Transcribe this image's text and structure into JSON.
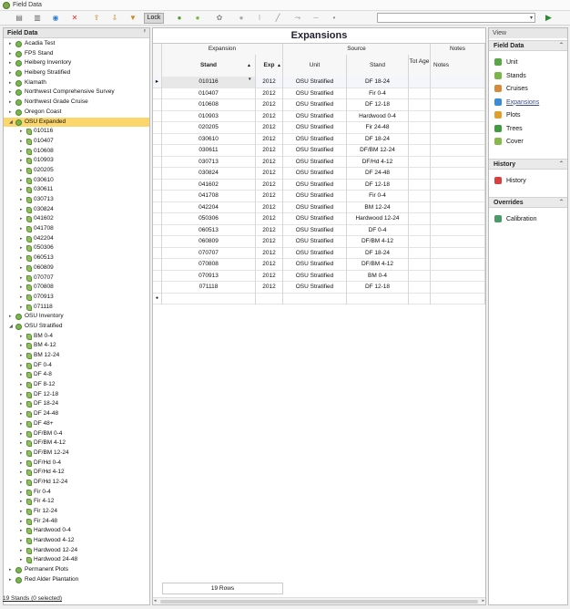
{
  "window": {
    "title": "Field Data"
  },
  "toolbar": {
    "lock_label": "Lock",
    "icons": [
      "save-icon",
      "save-all-icon",
      "view-icon",
      "delete-icon",
      "export-icon",
      "import-icon",
      "filter-icon",
      "node-icon",
      "stand-icon",
      "gear-icon",
      "circle-icon",
      "pin-icon",
      "line-icon",
      "split-icon",
      "arrow-icon",
      "dot-icon"
    ],
    "combo_value": "",
    "run_icon": "play-icon"
  },
  "left_panel": {
    "title": "Field Data",
    "items": [
      {
        "label": "Acadia Test",
        "level": 0,
        "toggle": "▸",
        "icon": "node"
      },
      {
        "label": "FPS Stand",
        "level": 0,
        "toggle": "▸",
        "icon": "node"
      },
      {
        "label": "Heiberg Inventory",
        "level": 0,
        "toggle": "▸",
        "icon": "node"
      },
      {
        "label": "Heiberg Stratified",
        "level": 0,
        "toggle": "▸",
        "icon": "node"
      },
      {
        "label": "Klamath",
        "level": 0,
        "toggle": "▸",
        "icon": "node"
      },
      {
        "label": "Northwest Comprehensive Survey",
        "level": 0,
        "toggle": "▸",
        "icon": "node"
      },
      {
        "label": "Northwest Grade Cruise",
        "level": 0,
        "toggle": "▸",
        "icon": "node"
      },
      {
        "label": "Oregon Coast",
        "level": 0,
        "toggle": "▸",
        "icon": "node"
      },
      {
        "label": "OSU Expanded",
        "level": 0,
        "toggle": "◢",
        "icon": "node",
        "selected": true
      },
      {
        "label": "010116",
        "level": 1,
        "toggle": "▸",
        "icon": "stand"
      },
      {
        "label": "010407",
        "level": 1,
        "toggle": "▸",
        "icon": "stand"
      },
      {
        "label": "010608",
        "level": 1,
        "toggle": "▸",
        "icon": "stand"
      },
      {
        "label": "010903",
        "level": 1,
        "toggle": "▸",
        "icon": "stand"
      },
      {
        "label": "020205",
        "level": 1,
        "toggle": "▸",
        "icon": "stand"
      },
      {
        "label": "030610",
        "level": 1,
        "toggle": "▸",
        "icon": "stand"
      },
      {
        "label": "030611",
        "level": 1,
        "toggle": "▸",
        "icon": "stand"
      },
      {
        "label": "030713",
        "level": 1,
        "toggle": "▸",
        "icon": "stand"
      },
      {
        "label": "030824",
        "level": 1,
        "toggle": "▸",
        "icon": "stand"
      },
      {
        "label": "041602",
        "level": 1,
        "toggle": "▸",
        "icon": "stand"
      },
      {
        "label": "041708",
        "level": 1,
        "toggle": "▸",
        "icon": "stand"
      },
      {
        "label": "042204",
        "level": 1,
        "toggle": "▸",
        "icon": "stand"
      },
      {
        "label": "050306",
        "level": 1,
        "toggle": "▸",
        "icon": "stand"
      },
      {
        "label": "060513",
        "level": 1,
        "toggle": "▸",
        "icon": "stand"
      },
      {
        "label": "060809",
        "level": 1,
        "toggle": "▸",
        "icon": "stand"
      },
      {
        "label": "070707",
        "level": 1,
        "toggle": "▸",
        "icon": "stand"
      },
      {
        "label": "070808",
        "level": 1,
        "toggle": "▸",
        "icon": "stand"
      },
      {
        "label": "070913",
        "level": 1,
        "toggle": "▸",
        "icon": "stand"
      },
      {
        "label": "071118",
        "level": 1,
        "toggle": "▸",
        "icon": "stand"
      },
      {
        "label": "OSU Inventory",
        "level": 0,
        "toggle": "▸",
        "icon": "node"
      },
      {
        "label": "OSU Stratified",
        "level": 0,
        "toggle": "◢",
        "icon": "node"
      },
      {
        "label": "BM 0-4",
        "level": 1,
        "toggle": "▸",
        "icon": "stand"
      },
      {
        "label": "BM 4-12",
        "level": 1,
        "toggle": "▸",
        "icon": "stand"
      },
      {
        "label": "BM 12-24",
        "level": 1,
        "toggle": "▸",
        "icon": "stand"
      },
      {
        "label": "DF 0-4",
        "level": 1,
        "toggle": "▸",
        "icon": "stand"
      },
      {
        "label": "DF 4-8",
        "level": 1,
        "toggle": "▸",
        "icon": "stand"
      },
      {
        "label": "DF 8-12",
        "level": 1,
        "toggle": "▸",
        "icon": "stand"
      },
      {
        "label": "DF 12-18",
        "level": 1,
        "toggle": "▸",
        "icon": "stand"
      },
      {
        "label": "DF 18-24",
        "level": 1,
        "toggle": "▸",
        "icon": "stand"
      },
      {
        "label": "DF 24-48",
        "level": 1,
        "toggle": "▸",
        "icon": "stand"
      },
      {
        "label": "DF 48+",
        "level": 1,
        "toggle": "▸",
        "icon": "stand"
      },
      {
        "label": "DF/BM 0-4",
        "level": 1,
        "toggle": "▸",
        "icon": "stand"
      },
      {
        "label": "DF/BM 4-12",
        "level": 1,
        "toggle": "▸",
        "icon": "stand"
      },
      {
        "label": "DF/BM 12-24",
        "level": 1,
        "toggle": "▸",
        "icon": "stand"
      },
      {
        "label": "DF/Hd 0-4",
        "level": 1,
        "toggle": "▸",
        "icon": "stand"
      },
      {
        "label": "DF/Hd 4-12",
        "level": 1,
        "toggle": "▸",
        "icon": "stand"
      },
      {
        "label": "DF/Hd 12-24",
        "level": 1,
        "toggle": "▸",
        "icon": "stand"
      },
      {
        "label": "Fir 0-4",
        "level": 1,
        "toggle": "▸",
        "icon": "stand"
      },
      {
        "label": "Fir 4-12",
        "level": 1,
        "toggle": "▸",
        "icon": "stand"
      },
      {
        "label": "Fir 12-24",
        "level": 1,
        "toggle": "▸",
        "icon": "stand"
      },
      {
        "label": "Fir 24-48",
        "level": 1,
        "toggle": "▸",
        "icon": "stand"
      },
      {
        "label": "Hardwood 0-4",
        "level": 1,
        "toggle": "▸",
        "icon": "stand"
      },
      {
        "label": "Hardwood 4-12",
        "level": 1,
        "toggle": "▸",
        "icon": "stand"
      },
      {
        "label": "Hardwood 12-24",
        "level": 1,
        "toggle": "▸",
        "icon": "stand"
      },
      {
        "label": "Hardwood 24-48",
        "level": 1,
        "toggle": "▸",
        "icon": "stand"
      },
      {
        "label": "Permanent Plots",
        "level": 0,
        "toggle": "▸",
        "icon": "node"
      },
      {
        "label": "Red Alder Plantation",
        "level": 0,
        "toggle": "▸",
        "icon": "node"
      }
    ],
    "status": "19 Stands (0 selected)"
  },
  "grid": {
    "title": "Expansions",
    "groups": {
      "expansion": "Expansion",
      "source": "Source",
      "notes": "Notes"
    },
    "columns": {
      "stand": "Stand",
      "exp": "Exp",
      "unit": "Unit",
      "src_stand": "Stand",
      "tot_age": "Tot Age",
      "notes": "Notes"
    },
    "rows": [
      [
        "010116",
        "2012",
        "OSU Stratified",
        "DF 18-24"
      ],
      [
        "010407",
        "2012",
        "OSU Stratified",
        "Fir 0-4"
      ],
      [
        "010608",
        "2012",
        "OSU Stratified",
        "DF 12-18"
      ],
      [
        "010903",
        "2012",
        "OSU Stratified",
        "Hardwood 0-4"
      ],
      [
        "020205",
        "2012",
        "OSU Stratified",
        "Fir 24-48"
      ],
      [
        "030610",
        "2012",
        "OSU Stratified",
        "DF 18-24"
      ],
      [
        "030611",
        "2012",
        "OSU Stratified",
        "DF/BM 12-24"
      ],
      [
        "030713",
        "2012",
        "OSU Stratified",
        "DF/Hd 4-12"
      ],
      [
        "030824",
        "2012",
        "OSU Stratified",
        "DF 24-48"
      ],
      [
        "041602",
        "2012",
        "OSU Stratified",
        "DF 12-18"
      ],
      [
        "041708",
        "2012",
        "OSU Stratified",
        "Fir 0-4"
      ],
      [
        "042204",
        "2012",
        "OSU Stratified",
        "BM 12-24"
      ],
      [
        "050306",
        "2012",
        "OSU Stratified",
        "Hardwood 12-24"
      ],
      [
        "060513",
        "2012",
        "OSU Stratified",
        "DF 0-4"
      ],
      [
        "060809",
        "2012",
        "OSU Stratified",
        "DF/BM 4-12"
      ],
      [
        "070707",
        "2012",
        "OSU Stratified",
        "DF 18-24"
      ],
      [
        "070808",
        "2012",
        "OSU Stratified",
        "DF/BM 4-12"
      ],
      [
        "070913",
        "2012",
        "OSU Stratified",
        "BM 0-4"
      ],
      [
        "071118",
        "2012",
        "OSU Stratified",
        "DF 12-18"
      ]
    ],
    "row_count": "19 Rows"
  },
  "view_panel": {
    "title": "View",
    "sections": [
      {
        "title": "Field Data",
        "items": [
          {
            "label": "Unit",
            "icon": "unit-icon",
            "color": "#5aa646"
          },
          {
            "label": "Stands",
            "icon": "stands-icon",
            "color": "#7ab648"
          },
          {
            "label": "Cruises",
            "icon": "cruises-icon",
            "color": "#d78a3a"
          },
          {
            "label": "Expansions",
            "icon": "expansions-icon",
            "color": "#3c8bd8",
            "active": true
          },
          {
            "label": "Plots",
            "icon": "plots-icon",
            "color": "#e0a030"
          },
          {
            "label": "Trees",
            "icon": "trees-icon",
            "color": "#3e9b3e"
          },
          {
            "label": "Cover",
            "icon": "cover-icon",
            "color": "#86b84a"
          }
        ]
      },
      {
        "title": "History",
        "items": [
          {
            "label": "History",
            "icon": "history-icon",
            "color": "#d84040"
          }
        ]
      },
      {
        "title": "Overrides",
        "items": [
          {
            "label": "Calibration",
            "icon": "calibration-icon",
            "color": "#4a9a6a"
          }
        ]
      }
    ]
  }
}
